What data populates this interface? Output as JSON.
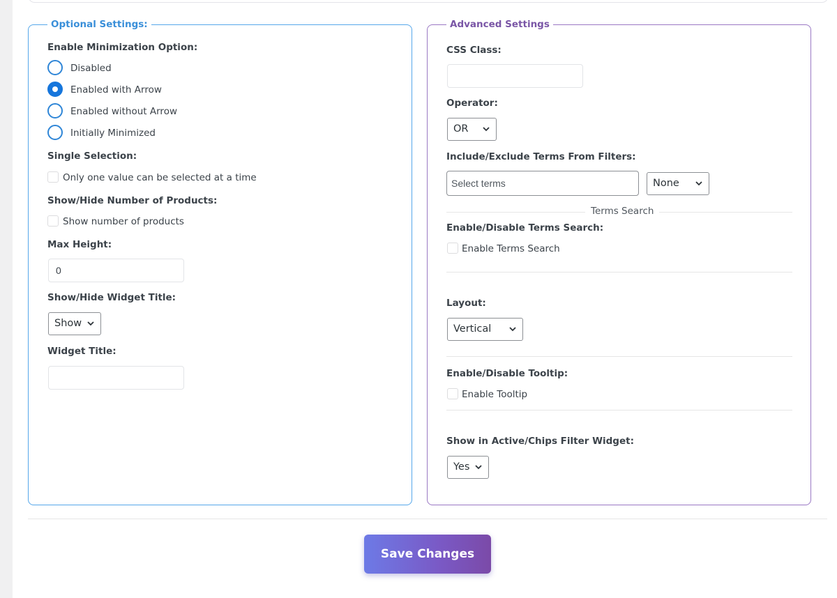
{
  "optional": {
    "legend": "Optional Settings:",
    "minimization": {
      "label": "Enable Minimization Option:",
      "options": [
        "Disabled",
        "Enabled with Arrow",
        "Enabled without Arrow",
        "Initially Minimized"
      ],
      "selected": "Enabled with Arrow"
    },
    "single_selection": {
      "label": "Single Selection:",
      "checkbox_label": "Only one value can be selected at a time",
      "checked": false
    },
    "show_products": {
      "label": "Show/Hide Number of Products:",
      "checkbox_label": "Show number of products",
      "checked": false
    },
    "max_height": {
      "label": "Max Height:",
      "value": "0"
    },
    "widget_title_toggle": {
      "label": "Show/Hide Widget Title:",
      "value": "Show"
    },
    "widget_title": {
      "label": "Widget Title:",
      "value": ""
    }
  },
  "advanced": {
    "legend": "Advanced Settings",
    "css_class": {
      "label": "CSS Class:",
      "value": ""
    },
    "operator": {
      "label": "Operator:",
      "value": "OR"
    },
    "include_exclude": {
      "label": "Include/Exclude Terms From Filters:",
      "placeholder": "Select terms",
      "mode": "None"
    },
    "terms_search_divider": "Terms Search",
    "terms_search": {
      "label": "Enable/Disable Terms Search:",
      "checkbox_label": "Enable Terms Search",
      "checked": false
    },
    "layout": {
      "label": "Layout:",
      "value": "Vertical"
    },
    "tooltip": {
      "label": "Enable/Disable Tooltip:",
      "checkbox_label": "Enable Tooltip",
      "checked": false
    },
    "chips": {
      "label": "Show in Active/Chips Filter Widget:",
      "value": "Yes"
    }
  },
  "save_button": "Save Changes",
  "colors": {
    "optional_border": "#55a7ea",
    "advanced_border": "#9a78c4",
    "radio_accent": "#1676dc",
    "button_gradient_start": "#6d7ae6",
    "button_gradient_end": "#7b4aa8"
  }
}
